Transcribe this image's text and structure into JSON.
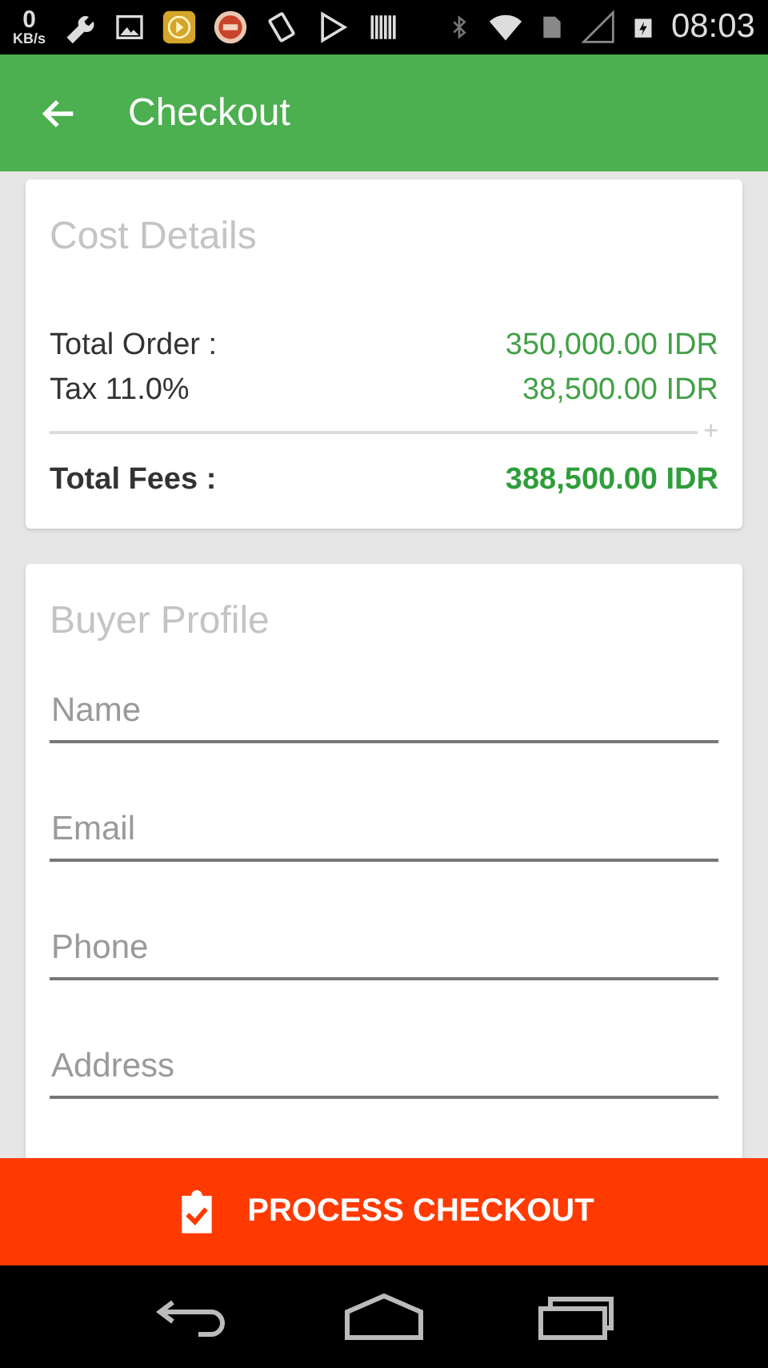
{
  "status_bar": {
    "speed_value": "0",
    "speed_unit": "KB/s",
    "time": "08:03"
  },
  "app_bar": {
    "title": "Checkout"
  },
  "cost_details": {
    "title": "Cost Details",
    "lines": [
      {
        "label": "Total Order :",
        "value": "350,000.00 IDR"
      },
      {
        "label": "Tax 11.0%",
        "value": "38,500.00 IDR"
      }
    ],
    "divider_mark": "+",
    "total": {
      "label": "Total Fees :",
      "value": "388,500.00 IDR"
    }
  },
  "buyer_profile": {
    "title": "Buyer Profile",
    "fields": [
      {
        "placeholder": "Name"
      },
      {
        "placeholder": "Email"
      },
      {
        "placeholder": "Phone"
      },
      {
        "placeholder": "Address"
      }
    ]
  },
  "checkout_button": {
    "label": "PROCESS CHECKOUT"
  }
}
